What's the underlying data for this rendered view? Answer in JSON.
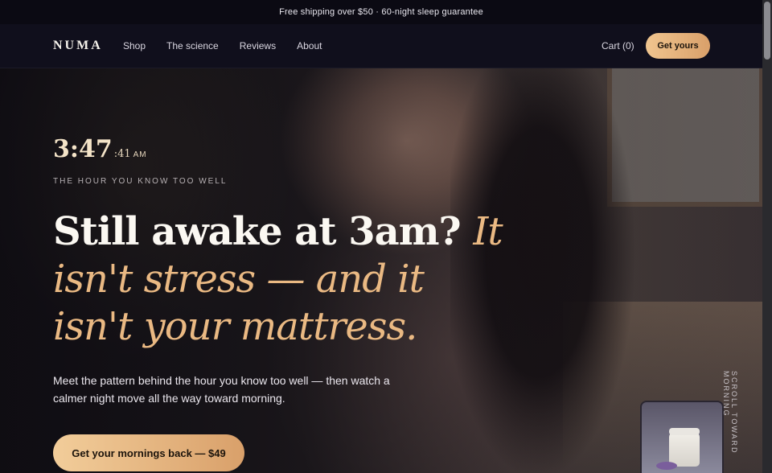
{
  "announcement": "Free shipping over $50 · 60-night sleep guarantee",
  "nav": {
    "logo": "NUMA",
    "links": [
      "Shop",
      "The science",
      "Reviews",
      "About"
    ],
    "cart": "Cart (0)",
    "cta": "Get yours"
  },
  "hero": {
    "clock": {
      "time": "3:47",
      "seconds": ":41",
      "ampm": "AM"
    },
    "eyebrow": "THE HOUR YOU KNOW TOO WELL",
    "headline_plain": "Still awake at 3am?",
    "headline_accent": "It isn't stress — and it isn't your mattress.",
    "lede": "Meet the pattern behind the hour you know too well — then watch a calmer night move all the way toward morning.",
    "cta": "Get your mornings back — $49",
    "scroll_hint": "SCROLL TOWARD MORNING"
  },
  "colors": {
    "accent": "#eab983",
    "nav_bg": "#100f1c",
    "announce_bg": "#0b0a13"
  },
  "icons": {
    "product_thumbnail": "jar-with-lavender"
  }
}
